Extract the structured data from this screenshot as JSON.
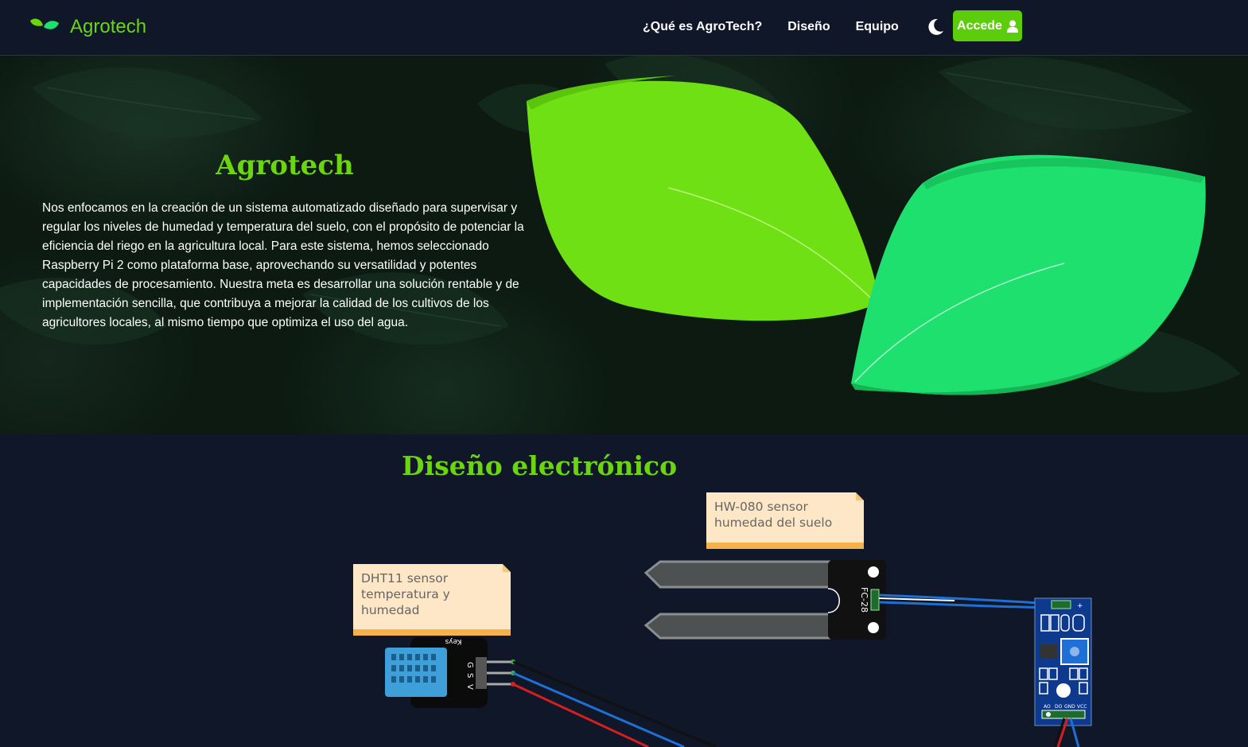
{
  "nav": {
    "brand": "Agrotech",
    "links": [
      "¿Qué es AgroTech?",
      "Diseño",
      "Equipo"
    ],
    "login_label": "Accede"
  },
  "hero": {
    "title": "Agrotech",
    "description": "Nos enfocamos en la creación de un sistema automatizado diseñado para supervisar y regular los niveles de humedad y temperatura del suelo, con el propósito de potenciar la eficiencia del riego en la agricultura local. Para este sistema, hemos seleccionado Raspberry Pi 2 como plataforma base, aprovechando su versatilidad y potentes capacidades de procesamiento. Nuestra meta es desarrollar una solución rentable y de implementación sencilla, que contribuya a mejorar la calidad de los cultivos de los agricultores locales, al mismo tiempo que optimiza el uso del agua."
  },
  "design": {
    "title": "Diseño electrónico",
    "notes": {
      "hw080": "HW-080 sensor humedad del suelo",
      "dht11": "DHT11 sensor temperatura y humedad"
    },
    "component_labels": {
      "fc28": "FC-28",
      "keys": "Keys",
      "pins": [
        "AO",
        "DO",
        "GND",
        "VCC"
      ],
      "dht_pins": [
        "G",
        "S",
        "V"
      ]
    }
  },
  "colors": {
    "accent": "#6bd60f",
    "navbar_bg": "#0f1729",
    "leaf_1": "#6ee013",
    "leaf_2": "#1ee06e",
    "note_bg": "#fde7c7",
    "note_border": "#f5b24a"
  },
  "icons": {
    "brand": "leaves-icon",
    "theme": "moon-icon",
    "login": "user-icon"
  }
}
